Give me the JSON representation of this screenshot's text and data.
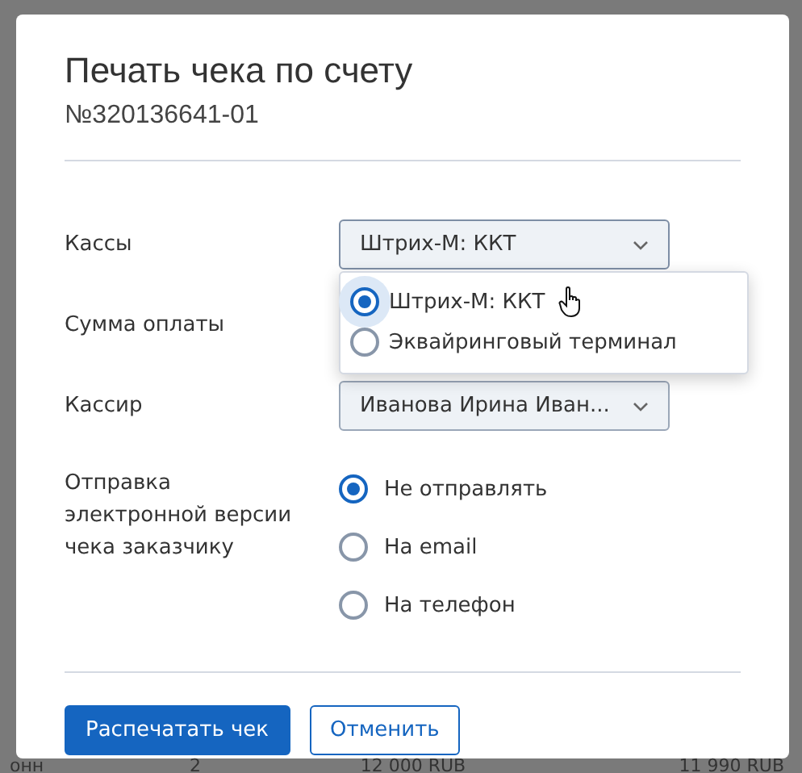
{
  "dialog": {
    "title": "Печать чека по счету",
    "subtitle": "№320136641-01",
    "fields": [
      {
        "kind": "select",
        "label": "Кассы",
        "value": "Штрих-М: ККТ",
        "expanded": true,
        "options": [
          {
            "label": "Штрих-М: ККТ",
            "selected": true
          },
          {
            "label": "Эквайринговый терминал",
            "selected": false
          }
        ]
      },
      {
        "kind": "hidden",
        "label": "Сумма оплаты"
      },
      {
        "kind": "select",
        "label": "Кассир",
        "value": "Иванова Ирина Иван...",
        "expanded": false
      },
      {
        "kind": "radio",
        "label": "Отправка электронной версии чека заказчику",
        "options": [
          {
            "label": "Не отправлять",
            "selected": true
          },
          {
            "label": "На email",
            "selected": false
          },
          {
            "label": "На телефон",
            "selected": false
          }
        ]
      }
    ],
    "buttons": [
      {
        "label": "Распечатать чек",
        "kind": "primary"
      },
      {
        "label": "Отменить",
        "kind": "secondary"
      }
    ]
  },
  "background_row": [
    "онн",
    "2",
    "12 000 RUB",
    "11 990 RUB"
  ]
}
